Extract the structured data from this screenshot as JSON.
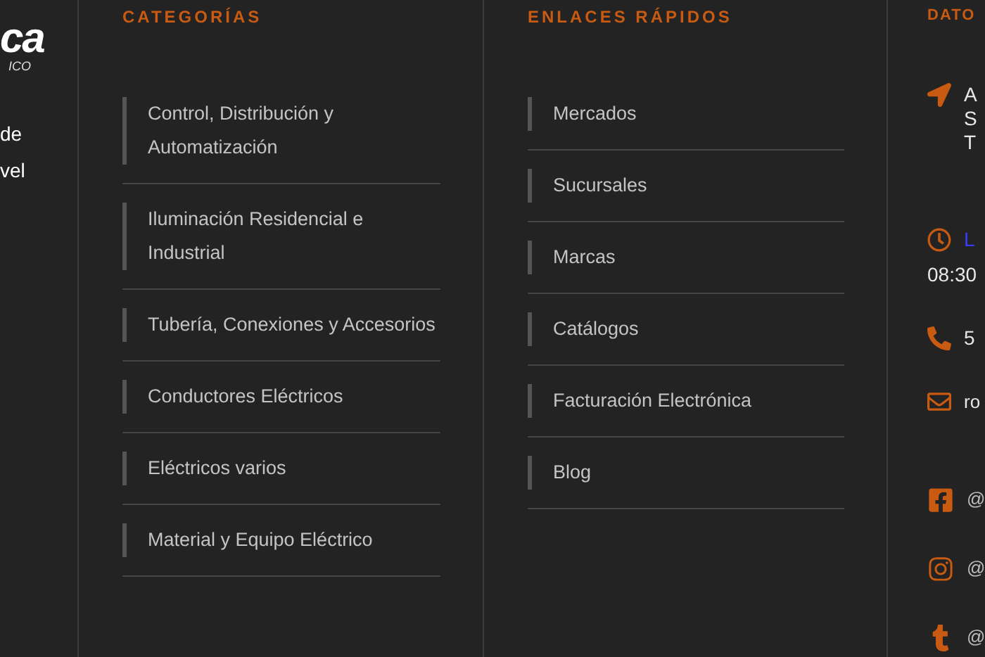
{
  "brand": {
    "logo": "ca",
    "tagline": "ICO"
  },
  "intro_lines": [
    "de",
    "vel"
  ],
  "categories": {
    "heading": "CATEGORÍAS",
    "items": [
      "Control, Distribución y Automatización",
      "Iluminación Residencial e Industrial",
      "Tubería, Conexiones y Accesorios",
      "Conductores Eléctricos",
      "Eléctricos varios",
      "Material y Equipo Eléctrico"
    ]
  },
  "quick_links": {
    "heading": "ENLACES RÁPIDOS",
    "items": [
      "Mercados",
      "Sucursales",
      "Marcas",
      "Catálogos",
      "Facturación Electrónica",
      "Blog"
    ]
  },
  "contact": {
    "heading": "DATO",
    "address_lines": [
      "A",
      "S",
      "T"
    ],
    "hours_label": "L",
    "hours": "08:30",
    "phone": "5",
    "email": "ro",
    "social": [
      {
        "kind": "facebook",
        "handle": "@"
      },
      {
        "kind": "instagram",
        "handle": "@"
      },
      {
        "kind": "tumblr",
        "handle": "@"
      }
    ]
  }
}
